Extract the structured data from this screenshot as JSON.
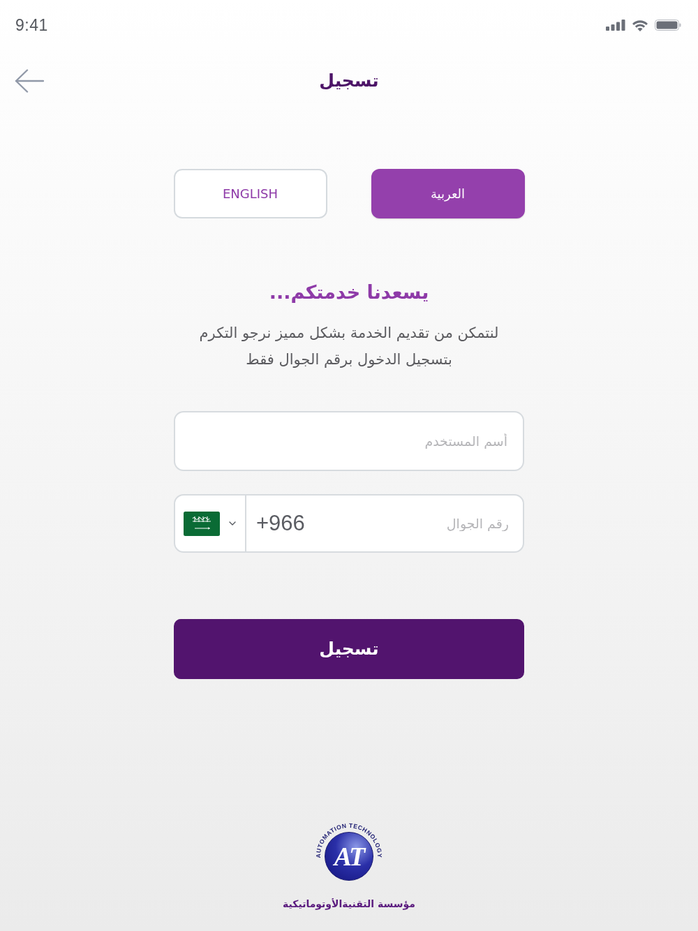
{
  "status_bar": {
    "time": "9:41"
  },
  "header": {
    "title": "تسجيل"
  },
  "languages": [
    {
      "label": "العربية",
      "selected": true
    },
    {
      "label": "ENGLISH",
      "selected": false
    }
  ],
  "welcome": {
    "heading": "يسعدنا خدمتكم...",
    "text": "لنتمكن من تقديم الخدمة بشكل مميز نرجو التكرم\nبتسجيل الدخول برقم الجوال فقط"
  },
  "form": {
    "username": {
      "placeholder": "أسم المستخدم"
    },
    "phone": {
      "dial_code": "+966",
      "placeholder": "رقم الجوال"
    }
  },
  "submit_button": {
    "label": "تسجيل"
  },
  "logo": {
    "ring_text": "AUTOMATION TECHNOLOGY",
    "letters": "AT",
    "caption": "مؤسسة التقنيةالأوتوماتيكية"
  }
}
